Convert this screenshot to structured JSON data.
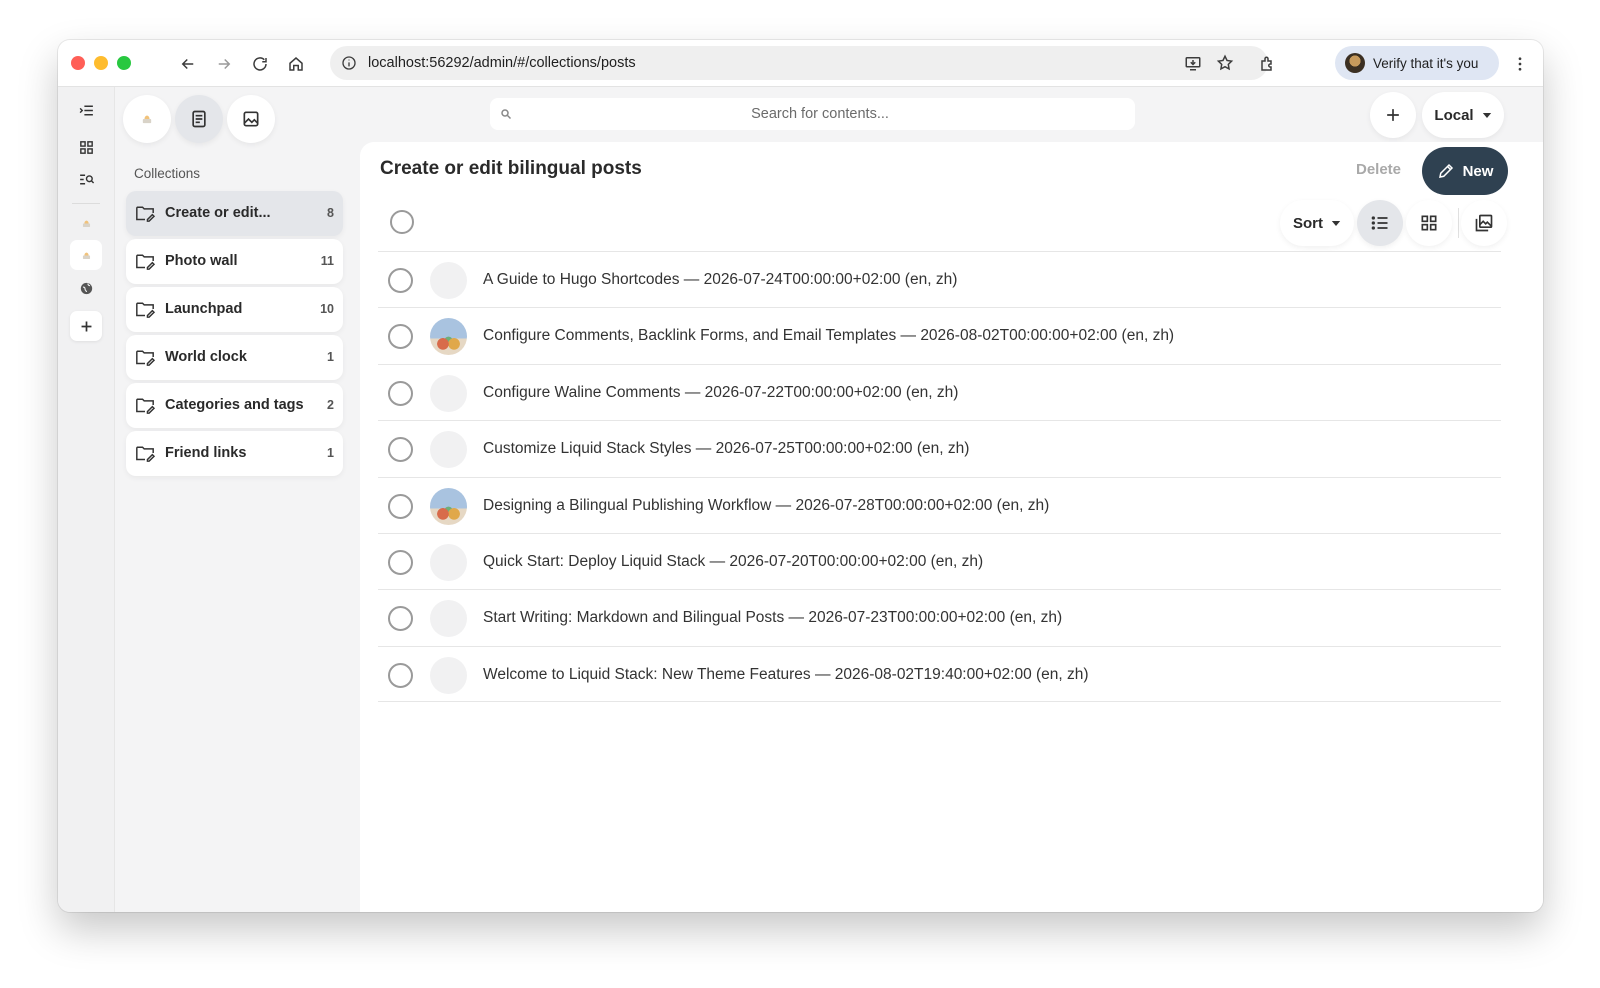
{
  "browser": {
    "url": "localhost:56292/admin/#/collections/posts",
    "profile_label": "Verify that it's you"
  },
  "search": {
    "placeholder": "Search for contents..."
  },
  "header": {
    "locale_label": "Local"
  },
  "sidebar": {
    "section_label": "Collections",
    "items": [
      {
        "label": "Create or edit...",
        "count": "8"
      },
      {
        "label": "Photo wall",
        "count": "11"
      },
      {
        "label": "Launchpad",
        "count": "10"
      },
      {
        "label": "World clock",
        "count": "1"
      },
      {
        "label": "Categories and tags",
        "count": "2"
      },
      {
        "label": "Friend links",
        "count": "1"
      }
    ]
  },
  "main": {
    "title": "Create or edit bilingual posts",
    "delete_label": "Delete",
    "new_label": "New",
    "sort_label": "Sort",
    "entries": [
      {
        "title": "A Guide to Hugo Shortcodes — 2026-07-24T00:00:00+02:00 (en, zh)"
      },
      {
        "title": "Configure Comments, Backlink Forms, and Email Templates — 2026-08-02T00:00:00+02:00 (en, zh)"
      },
      {
        "title": "Configure Waline Comments — 2026-07-22T00:00:00+02:00 (en, zh)"
      },
      {
        "title": "Customize Liquid Stack Styles — 2026-07-25T00:00:00+02:00 (en, zh)"
      },
      {
        "title": "Designing a Bilingual Publishing Workflow — 2026-07-28T00:00:00+02:00 (en, zh)"
      },
      {
        "title": "Quick Start: Deploy Liquid Stack — 2026-07-20T00:00:00+02:00 (en, zh)"
      },
      {
        "title": "Start Writing: Markdown and Bilingual Posts — 2026-07-23T00:00:00+02:00 (en, zh)"
      },
      {
        "title": "Welcome to Liquid Stack: New Theme Features — 2026-08-02T19:40:00+02:00 (en, zh)"
      }
    ]
  },
  "colors": {
    "accent": "#2f4151",
    "active_bg": "#e4e6ea",
    "panel_bg": "#f4f4f5"
  }
}
